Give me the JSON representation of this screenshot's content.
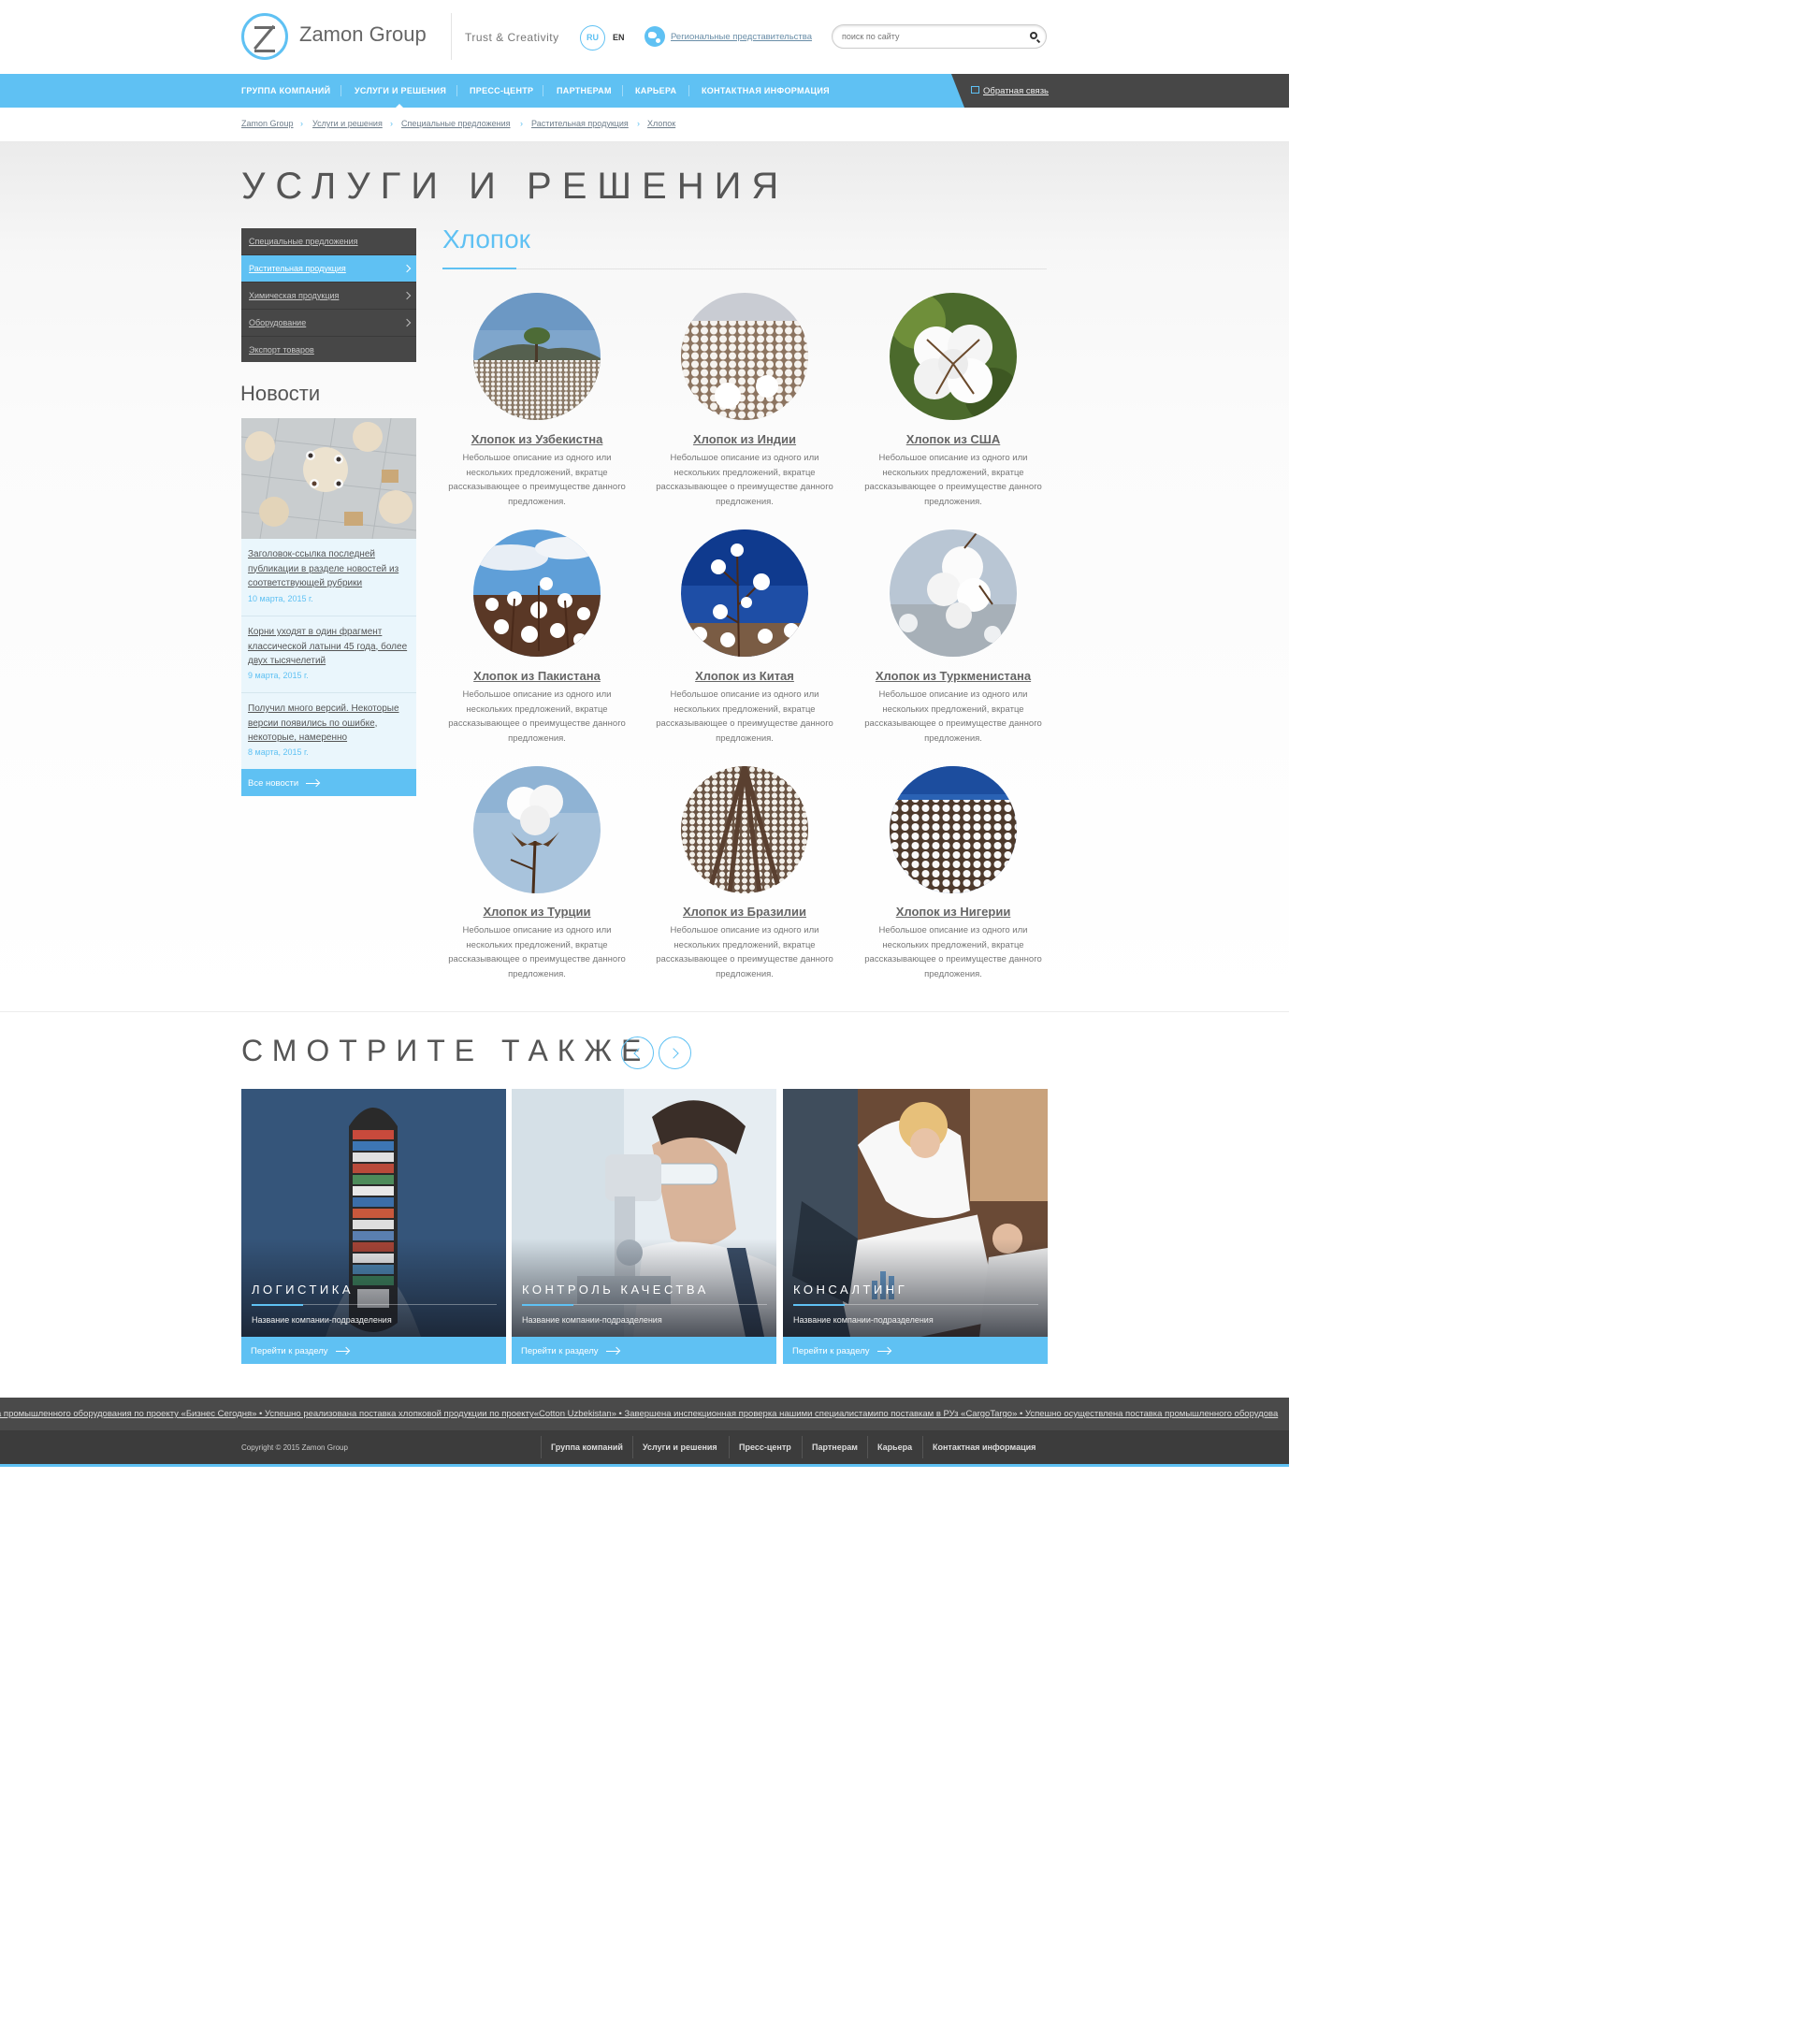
{
  "header": {
    "brand": "Zamon Group",
    "slogan": "Trust & Creativity",
    "lang_active": "RU",
    "lang_other": "EN",
    "regional_link": "Региональные представительства",
    "search_placeholder": "поиск по сайту"
  },
  "nav": {
    "items": [
      "Группа компаний",
      "Услуги и решения",
      "Пресс-центр",
      "Партнерам",
      "Карьера",
      "Контактная информация"
    ],
    "active_index": 1,
    "feedback": "Обратная связь"
  },
  "breadcrumbs": [
    "Zamon Group",
    "Услуги и решения",
    "Специальные предложения",
    "Растительная продукция",
    "Хлопок"
  ],
  "page_title": "Услуги и решения",
  "sidebar": {
    "items": [
      "Специальные предложения",
      "Растительная продукция",
      "Химическая продукция",
      "Оборудование",
      "Экспорт товаров"
    ],
    "active_index": 1
  },
  "news": {
    "title": "Новости",
    "items": [
      {
        "text": "Заголовок-ссылка последней публикации в разделе новостей из соответствующей рубрики",
        "date": "10 марта, 2015 г."
      },
      {
        "text": "Корни уходят в один фрагмент классической латыни 45 года, более двух тысячелетий",
        "date": "9 марта, 2015 г."
      },
      {
        "text": "Получил много версий. Некоторые версии появились по ошибке, некоторые, намеренно",
        "date": "8 марта, 2015 г."
      }
    ],
    "all_news": "Все новости"
  },
  "section": {
    "title": "Хлопок",
    "cards": [
      {
        "title": "Хлопок из Узбекистна",
        "desc": "Небольшое описание из одного или нескольких предложений, вкратце рассказывающее о преимуществе данного предложения."
      },
      {
        "title": "Хлопок из Индии",
        "desc": "Небольшое описание из одного или нескольких предложений, вкратце рассказывающее о преимуществе данного предложения."
      },
      {
        "title": "Хлопок из США",
        "desc": "Небольшое описание из одного или нескольких предложений, вкратце рассказывающее о преимуществе данного предложения."
      },
      {
        "title": "Хлопок из Пакистана",
        "desc": "Небольшое описание из одного или нескольких предложений, вкратце рассказывающее о преимуществе данного предложения."
      },
      {
        "title": "Хлопок из Китая",
        "desc": "Небольшое описание из одного или нескольких предложений, вкратце рассказывающее о преимуществе данного предложения."
      },
      {
        "title": "Хлопок из Туркменистана",
        "desc": "Небольшое описание из одного или нескольких предложений, вкратце рассказывающее о преимуществе данного предложения."
      },
      {
        "title": "Хлопок из Турции",
        "desc": "Небольшое описание из одного или нескольких предложений, вкратце рассказывающее о преимуществе данного предложения."
      },
      {
        "title": "Хлопок из Бразилии",
        "desc": "Небольшое описание из одного или нескольких предложений, вкратце рассказывающее о преимуществе данного предложения."
      },
      {
        "title": "Хлопок из Нигерии",
        "desc": "Небольшое описание из одного или нескольких предложений, вкратце рассказывающее о преимуществе данного предложения."
      }
    ]
  },
  "see_also": {
    "title": "Смотрите также",
    "tiles": [
      {
        "title": "Логистика",
        "subtitle": "Название компании-подразделения",
        "button": "Перейти к разделу"
      },
      {
        "title": "Контроль качества",
        "subtitle": "Название компании-подразделения",
        "button": "Перейти к разделу"
      },
      {
        "title": "Консалтинг",
        "subtitle": "Название компании-подразделения",
        "button": "Перейти к разделу"
      }
    ]
  },
  "ticker": "а промышленного оборудования по проекту «Бизнес Сегодня»  •  Успешно реализована поставка хлопковой продукции по проекту«Cotton Uzbekistan»  •  Завершена инспекционная проверка нашими специалистамипо поставкам в РУз «CargoTargo»  •  Успешно осуществлена поставка промышленного оборудова",
  "footer": {
    "copyright": "Copyright © 2015 Zamon Group",
    "links": [
      "Группа компаний",
      "Услуги и решения",
      "Пресс-центр",
      "Партнерам",
      "Карьера",
      "Контактная информация"
    ]
  },
  "colors": {
    "accent": "#5fc1f3",
    "dark": "#474747",
    "text": "#555555"
  },
  "icons": [
    "logo-icon",
    "globe-icon",
    "search-icon",
    "feedback-icon",
    "chevron-right-icon",
    "arrow-right-icon",
    "chevron-left-icon"
  ]
}
